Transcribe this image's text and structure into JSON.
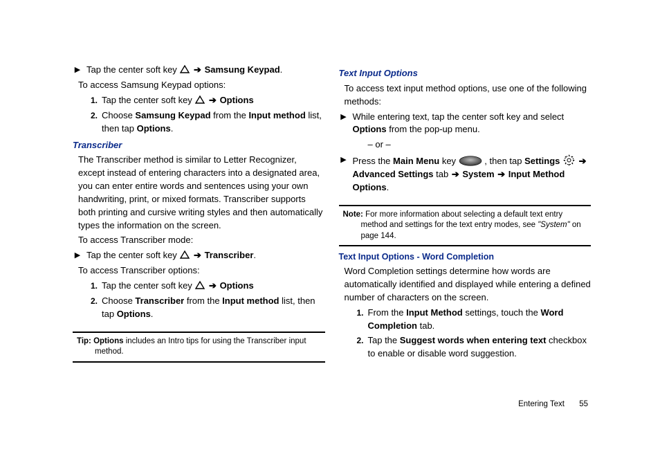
{
  "footer": {
    "section": "Entering Text",
    "page": "55"
  },
  "left": {
    "line1_pre": "Tap the center soft key ",
    "line1_post": " Samsung Keypad",
    "access_keypad": "To access Samsung Keypad options:",
    "step1_pre": "Tap the center soft key ",
    "step1_post": " Options",
    "step2_a": "Choose ",
    "step2_b": "Samsung Keypad",
    "step2_c": " from the ",
    "step2_d": "Input method",
    "step2_e": " list, then tap ",
    "step2_f": "Options",
    "h_transcriber": "Transcriber",
    "trans_body": "The Transcriber method is similar to Letter Recognizer, except instead of entering characters into a designated area, you can enter entire words and sentences using your own handwriting, print, or mixed formats. Transcriber supports both printing and cursive writing styles and then automatically types the information on the screen.",
    "access_trans_mode": "To access Transcriber mode:",
    "trans_mode_pre": "Tap the center soft key ",
    "trans_mode_post": " Transcriber",
    "access_trans_opts": "To access Transcriber options:",
    "t_step1_pre": "Tap the center soft key ",
    "t_step1_post": " Options",
    "t_step2_a": "Choose ",
    "t_step2_b": "Transcriber",
    "t_step2_c": " from the ",
    "t_step2_d": "Input method",
    "t_step2_e": " list, then tap ",
    "t_step2_f": "Options",
    "tip_label": "Tip: ",
    "tip_b": "Options",
    "tip_body": " includes an Intro tips for using the Transcriber input method."
  },
  "right": {
    "h_text_input": "Text Input Options",
    "intro": "To access text input method options, use one of the following methods:",
    "m1_a": "While entering text, tap the center soft key and select ",
    "m1_b": "Options",
    "m1_c": " from the pop-up menu.",
    "or": "– or –",
    "m2_a": "Press the ",
    "m2_b": "Main Menu",
    "m2_c": "  key ",
    "m2_d": ", then tap ",
    "m2_e": "Settings",
    "m2_f": " ",
    "m2_g": "Advanced Settings",
    "m2_h": " tab ",
    "m2_i": "System",
    "m2_j": "Input Method Options",
    "note_label": "Note: ",
    "note_body_a": "For more information about selecting a default text entry method and settings for the text entry modes, see ",
    "note_body_b": "\"System\"",
    "note_body_c": " on page 144.",
    "h_word": "Text Input Options - Word Completion",
    "word_body": "Word Completion settings determine how words are automatically identified and displayed while entering a defined number of characters on the screen.",
    "w1_a": "From the ",
    "w1_b": "Input Method",
    "w1_c": " settings, touch the ",
    "w1_d": "Word Completion",
    "w1_e": " tab.",
    "w2_a": "Tap the ",
    "w2_b": "Suggest words when entering text",
    "w2_c": " checkbox to enable or disable word suggestion."
  }
}
